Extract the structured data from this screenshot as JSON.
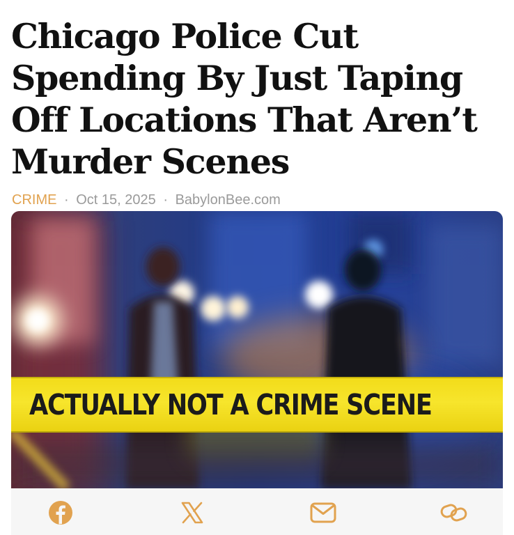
{
  "article": {
    "headline": "Chicago Police Cut Spending By Just Taping Off Locations That Aren’t Murder Scenes",
    "category": "CRIME",
    "separator": "·",
    "date": "Oct 15, 2025",
    "source": "BabylonBee.com"
  },
  "image": {
    "tape_text": "ACTUALLY NOT A CRIME SCENE"
  },
  "share": {
    "icons": [
      "facebook-icon",
      "x-icon",
      "mail-icon",
      "link-icon"
    ],
    "icon_color": "#e1a24f"
  },
  "colors": {
    "accent": "#e1a24f",
    "headline": "#111111",
    "meta": "#9a9a9a",
    "tape": "#f4df1f"
  }
}
